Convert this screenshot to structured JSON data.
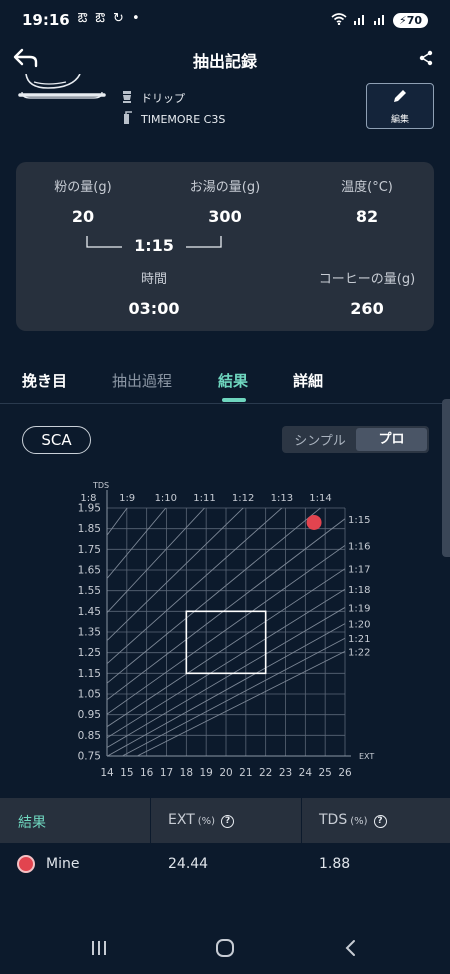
{
  "status_bar": {
    "time": "19:16",
    "icons_left": "ఔ ఔ ↻ •",
    "battery": "70"
  },
  "app_bar": {
    "title": "抽出記録",
    "back_icon": "back-arrow-icon",
    "share_icon": "share-icon"
  },
  "recipe": {
    "method": "ドリップ",
    "grinder": "TIMEMORE C3S",
    "edit_label": "編集"
  },
  "params": {
    "coffee_label": "粉の量(g)",
    "coffee_value": "20",
    "water_label": "お湯の量(g)",
    "water_value": "300",
    "temp_label": "温度(°C)",
    "temp_value": "82",
    "ratio": "1:15",
    "time_label": "時間",
    "time_value": "03:00",
    "yield_label": "コーヒーの量(g)",
    "yield_value": "260"
  },
  "tabs": [
    {
      "label": "挽き目",
      "active": false
    },
    {
      "label": "抽出過程",
      "active": false
    },
    {
      "label": "結果",
      "active": true
    },
    {
      "label": "詳細",
      "active": false
    }
  ],
  "sca_label": "SCA",
  "mode": {
    "simple": "シンプル",
    "pro": "プロ",
    "selected": "プロ"
  },
  "chart_data": {
    "type": "scatter",
    "xlabel": "EXT",
    "ylabel": "TDS",
    "xlim": [
      14,
      26
    ],
    "ylim": [
      0.75,
      1.95
    ],
    "x_ticks": [
      "14",
      "15",
      "16",
      "17",
      "18",
      "19",
      "20",
      "21",
      "22",
      "23",
      "24",
      "25",
      "26"
    ],
    "y_ticks": [
      "0.75",
      "0.85",
      "0.95",
      "1.05",
      "1.15",
      "1.25",
      "1.35",
      "1.45",
      "1.55",
      "1.65",
      "1.75",
      "1.85",
      "1.95"
    ],
    "ratio_lines": [
      "1:8",
      "1:9",
      "1:10",
      "1:11",
      "1:12",
      "1:13",
      "1:14",
      "1:15",
      "1:16",
      "1:17",
      "1:18",
      "1:19",
      "1:20",
      "1:21",
      "1:22"
    ],
    "ideal_box": {
      "ext": [
        18,
        22
      ],
      "tds": [
        1.15,
        1.45
      ]
    },
    "points": [
      {
        "name": "Mine",
        "ext": 24.44,
        "tds": 1.88,
        "color": "#e2444f"
      }
    ]
  },
  "results_table": {
    "headers": {
      "result": "結果",
      "ext": "EXT",
      "ext_unit": "(%)",
      "tds": "TDS",
      "tds_unit": "(%)"
    },
    "rows": [
      {
        "name": "Mine",
        "ext": "24.44",
        "tds": "1.88"
      }
    ]
  },
  "colors": {
    "accent": "#6fd6bf",
    "background": "#0c1a2c",
    "card": "#27303d",
    "point": "#e2444f"
  }
}
